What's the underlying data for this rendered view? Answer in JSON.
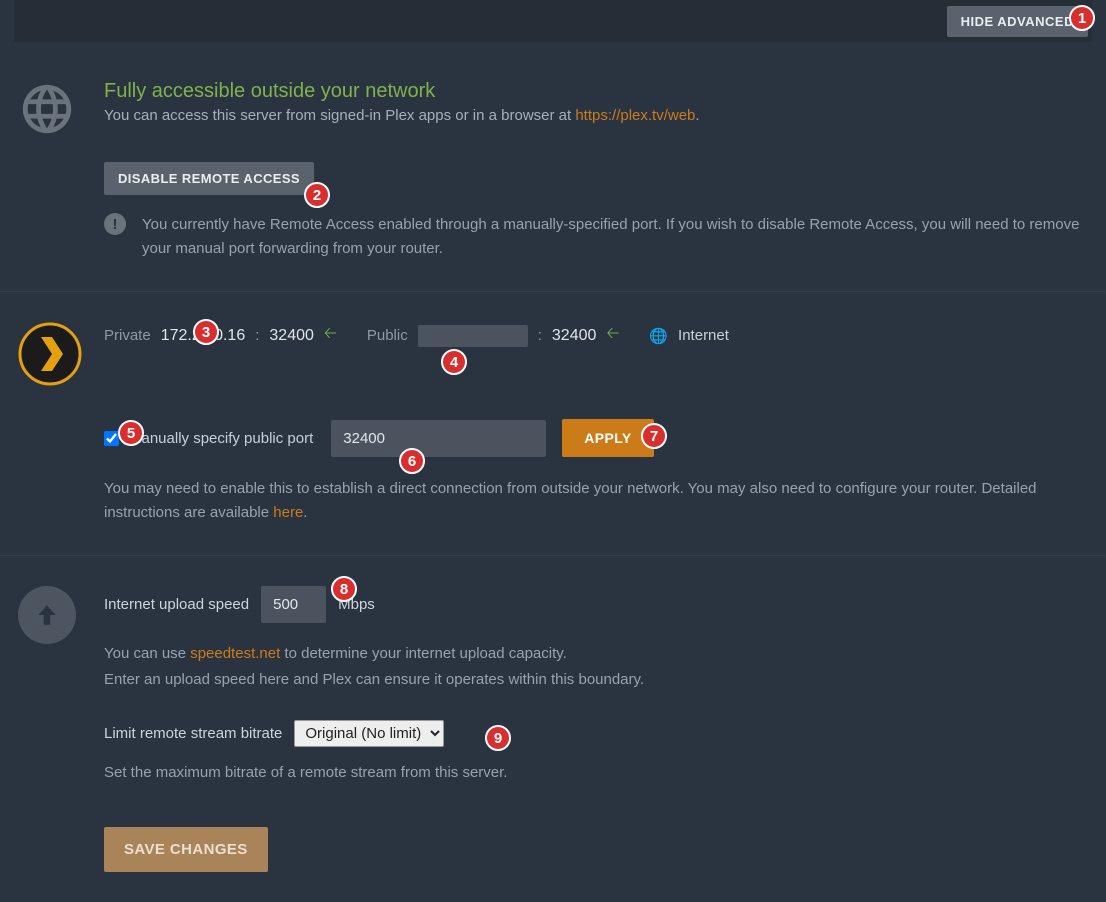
{
  "topbar": {
    "hide_advanced": "HIDE ADVANCED"
  },
  "access": {
    "title": "Fully accessible outside your network",
    "desc_prefix": "You can access this server from signed-in Plex apps or in a browser at ",
    "link_text": "https://plex.tv/web",
    "desc_suffix": ".",
    "disable_label": "DISABLE REMOTE ACCESS",
    "notice_text": "You currently have Remote Access enabled through a manually-specified port. If you wish to disable Remote Access, you will need to remove your manual port forwarding from your router."
  },
  "network": {
    "private_label": "Private",
    "private_ip": "172.21.0.16",
    "private_port": "32400",
    "public_label": "Public",
    "public_ip": "",
    "public_port": "32400",
    "internet_label": "Internet",
    "manual_check_label": "Manually specify public port",
    "manual_checked": true,
    "manual_port_value": "32400",
    "apply_label": "APPLY",
    "help_prefix": "You may need to enable this to establish a direct connection from outside your network. You may also need to configure your router. Detailed instructions are available ",
    "help_link": "here",
    "help_suffix": "."
  },
  "upload": {
    "speed_label": "Internet upload speed",
    "speed_value": "500",
    "speed_unit": "Mbps",
    "help1_prefix": "You can use ",
    "help1_link": "speedtest.net",
    "help1_suffix": " to determine your internet upload capacity.",
    "help2": "Enter an upload speed here and Plex can ensure it operates within this boundary.",
    "bitrate_label": "Limit remote stream bitrate",
    "bitrate_value": "Original (No limit)",
    "bitrate_help": "Set the maximum bitrate of a remote stream from this server.",
    "save_label": "SAVE CHANGES"
  },
  "badges": [
    "1",
    "2",
    "3",
    "4",
    "5",
    "6",
    "7",
    "8",
    "9"
  ]
}
